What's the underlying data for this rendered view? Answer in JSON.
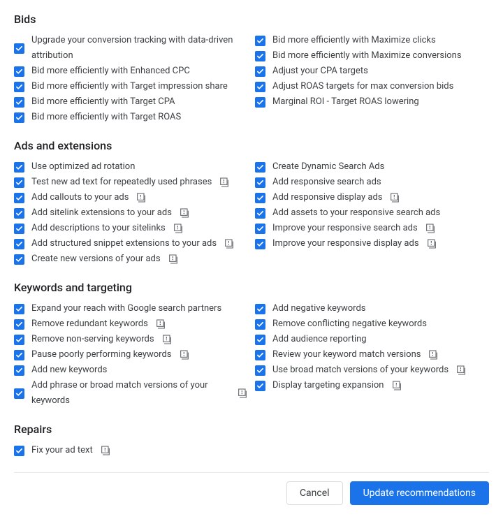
{
  "sections": [
    {
      "title": "Bids",
      "left": [
        {
          "label": "Upgrade your conversion tracking with data-driven attribution",
          "info": false
        },
        {
          "label": "Bid more efficiently with Enhanced CPC",
          "info": false
        },
        {
          "label": "Bid more efficiently with Target impression share",
          "info": false
        },
        {
          "label": "Bid more efficiently with Target CPA",
          "info": false
        },
        {
          "label": "Bid more efficiently with Target ROAS",
          "info": false
        }
      ],
      "right": [
        {
          "label": "Bid more efficiently with Maximize clicks",
          "info": false
        },
        {
          "label": "Bid more efficiently with Maximize conversions",
          "info": false
        },
        {
          "label": "Adjust your CPA targets",
          "info": false
        },
        {
          "label": "Adjust ROAS targets for max conversion bids",
          "info": false
        },
        {
          "label": "Marginal ROI - Target ROAS lowering",
          "info": false
        }
      ]
    },
    {
      "title": "Ads and extensions",
      "left": [
        {
          "label": "Use optimized ad rotation",
          "info": false
        },
        {
          "label": "Test new ad text for repeatedly used phrases",
          "info": true
        },
        {
          "label": "Add callouts to your ads",
          "info": true
        },
        {
          "label": "Add sitelink extensions to your ads",
          "info": true
        },
        {
          "label": "Add descriptions to your sitelinks",
          "info": true
        },
        {
          "label": "Add structured snippet extensions to your ads",
          "info": true
        },
        {
          "label": "Create new versions of your ads",
          "info": true
        }
      ],
      "right": [
        {
          "label": "Create Dynamic Search Ads",
          "info": false
        },
        {
          "label": "Add responsive search ads",
          "info": false
        },
        {
          "label": "Add responsive display ads",
          "info": true
        },
        {
          "label": "Add assets to your responsive search ads",
          "info": false
        },
        {
          "label": "Improve your responsive search ads",
          "info": true
        },
        {
          "label": "Improve your responsive display ads",
          "info": true
        }
      ]
    },
    {
      "title": "Keywords and targeting",
      "left": [
        {
          "label": "Expand your reach with Google search partners",
          "info": false
        },
        {
          "label": "Remove redundant keywords",
          "info": true
        },
        {
          "label": "Remove non-serving keywords",
          "info": true
        },
        {
          "label": "Pause poorly performing keywords",
          "info": true
        },
        {
          "label": "Add new keywords",
          "info": false
        },
        {
          "label": "Add phrase or broad match versions of your keywords",
          "info": true
        }
      ],
      "right": [
        {
          "label": "Add negative keywords",
          "info": false
        },
        {
          "label": "Remove conflicting negative keywords",
          "info": false
        },
        {
          "label": "Add audience reporting",
          "info": false
        },
        {
          "label": "Review your keyword match versions",
          "info": true
        },
        {
          "label": "Use broad match versions of your keywords",
          "info": true
        },
        {
          "label": "Display targeting expansion",
          "info": true
        }
      ]
    },
    {
      "title": "Repairs",
      "left": [
        {
          "label": "Fix your ad text",
          "info": true
        }
      ],
      "right": []
    }
  ],
  "footer": {
    "cancel": "Cancel",
    "update": "Update recommendations"
  }
}
